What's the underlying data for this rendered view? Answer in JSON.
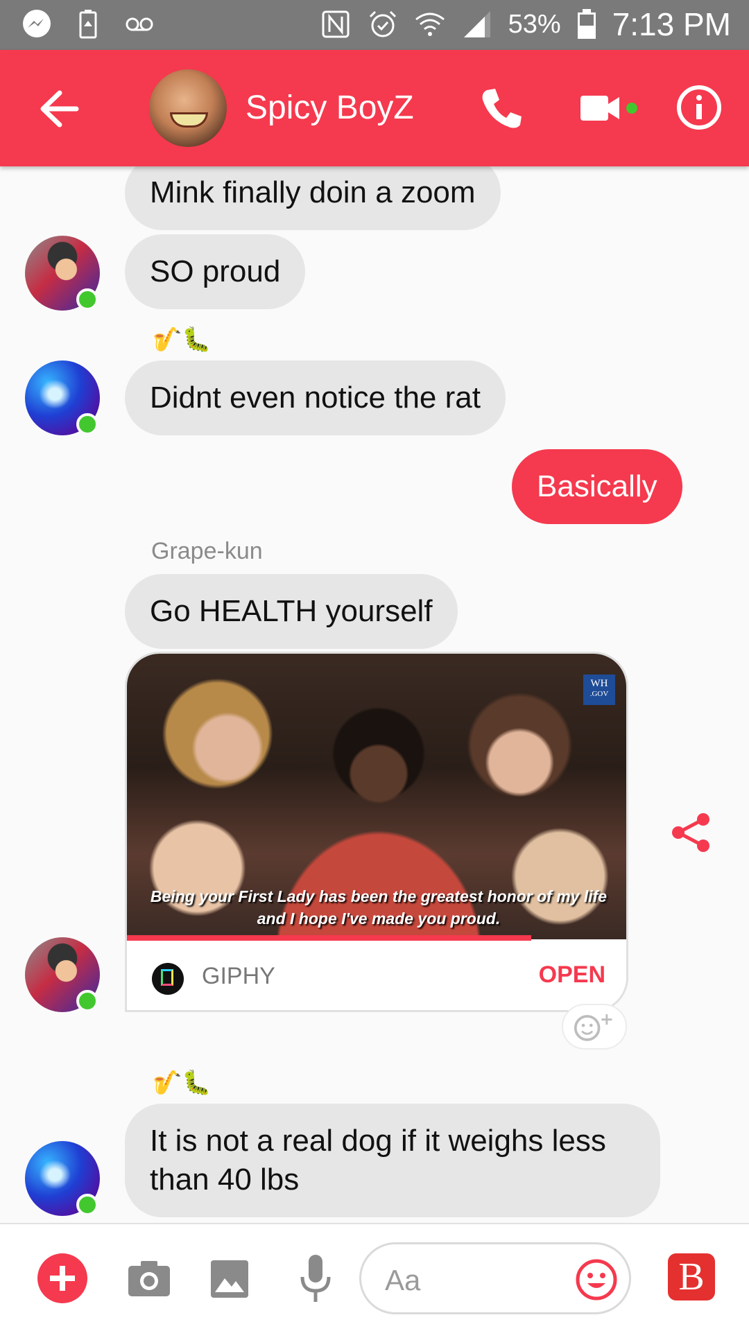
{
  "status_bar": {
    "battery": "53%",
    "time": "7:13 PM",
    "icons": [
      "messenger-icon",
      "battery-saver-icon",
      "voicemail-icon",
      "nfc-icon",
      "alarm-icon",
      "wifi-icon",
      "signal-icon",
      "battery-icon"
    ]
  },
  "header": {
    "title": "Spicy BoyZ",
    "accent_color": "#f5394e",
    "icons": [
      "back-arrow-icon",
      "phone-icon",
      "video-camera-icon",
      "info-icon"
    ]
  },
  "messages": [
    {
      "text": "Mink finally doin a zoom",
      "sender": "",
      "mine": false
    },
    {
      "text": "SO proud",
      "sender": "",
      "mine": false
    },
    {
      "reaction": "🎷🐛"
    },
    {
      "text": "Didnt even notice the rat",
      "sender": "",
      "mine": false
    },
    {
      "text": "Basically",
      "mine": true
    },
    {
      "sender_label": "Grape-kun"
    },
    {
      "text": "Go HEALTH yourself",
      "mine": false
    },
    {
      "reaction": "🎷🐛"
    },
    {
      "text": "It is not a real dog if it weighs less than 40 lbs",
      "mine": false
    }
  ],
  "gif": {
    "caption_line1": "Being your First Lady has been the greatest honor of my life",
    "caption_line2": "and I hope I've made you proud.",
    "watermark_line1": "WH",
    "watermark_line2": ".GOV",
    "provider": "GIPHY",
    "provider_logo_text": "GIPHY",
    "open_label": "OPEN",
    "progress": 0.81
  },
  "composer": {
    "placeholder": "Aa",
    "app_label": "B",
    "icons": [
      "plus-icon",
      "camera-icon",
      "image-icon",
      "microphone-icon",
      "emoji-icon",
      "app-icon"
    ]
  }
}
